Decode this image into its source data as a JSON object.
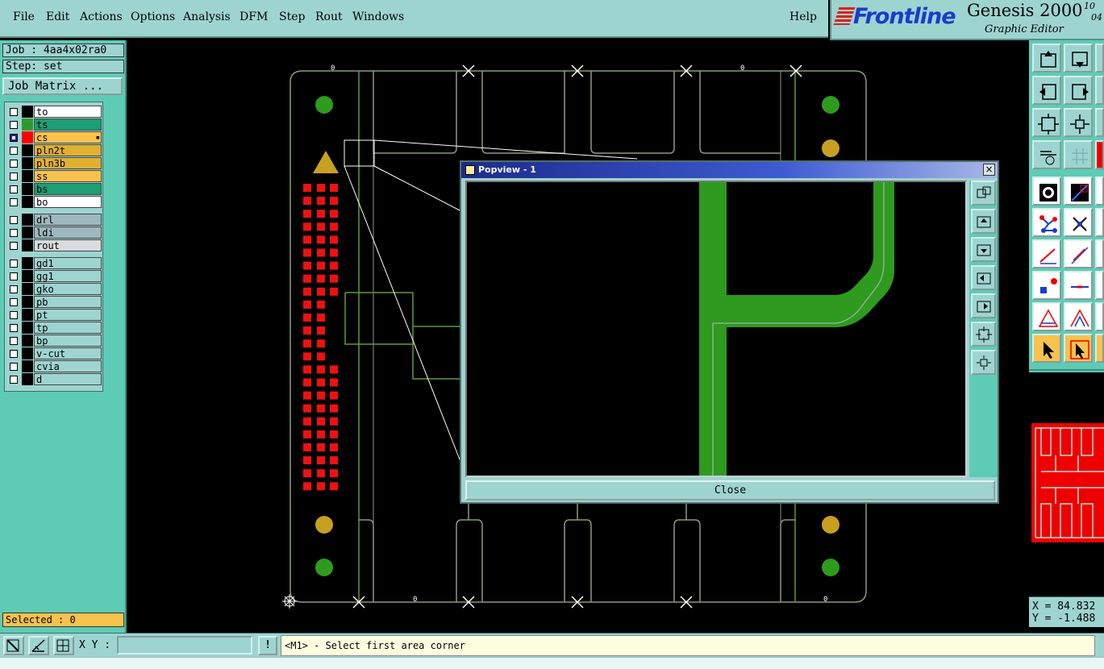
{
  "menubar": {
    "items": [
      "File",
      "Edit",
      "Actions",
      "Options",
      "Analysis",
      "DFM",
      "Step",
      "Rout",
      "Windows"
    ],
    "help": "Help"
  },
  "brand": {
    "logo": "Frontline",
    "product": "Genesis 2000",
    "subtitle": "Graphic Editor",
    "date_line1": "10",
    "date_line2": "04",
    "logo_color": "#1a3ccc"
  },
  "job": {
    "job_label": "Job : 4aa4x02ra0",
    "step_label": "Step: set",
    "matrix_button": "Job Matrix ..."
  },
  "layers": [
    {
      "name": "to",
      "color": "#ffffff",
      "swatch": "#000000",
      "checked": false
    },
    {
      "name": "ts",
      "color": "#1d9e73",
      "swatch": "#2e9a2e",
      "checked": false
    },
    {
      "name": "cs",
      "color": "#f7c24d",
      "swatch": "#ff0000",
      "checked": true,
      "marker": "▪"
    },
    {
      "name": "pln2t",
      "color": "#e0b030",
      "swatch": "#000000",
      "checked": false
    },
    {
      "name": "pln3b",
      "color": "#e0b030",
      "swatch": "#000000",
      "checked": false
    },
    {
      "name": "ss",
      "color": "#f7c24d",
      "swatch": "#000000",
      "checked": false
    },
    {
      "name": "bs",
      "color": "#1d9e73",
      "swatch": "#000000",
      "checked": false
    },
    {
      "name": "bo",
      "color": "#ffffff",
      "swatch": "#000000",
      "checked": false
    },
    {
      "name": "drl",
      "color": "#9fb8bd",
      "swatch": "#000000",
      "checked": false
    },
    {
      "name": "ldi",
      "color": "#9fb8bd",
      "swatch": "#000000",
      "checked": false
    },
    {
      "name": "rout",
      "color": "#d8dcdc",
      "swatch": "#000000",
      "checked": false
    },
    {
      "name": "gd1",
      "color": "#9ed4d0",
      "swatch": "#000000",
      "checked": false
    },
    {
      "name": "gg1",
      "color": "#9ed4d0",
      "swatch": "#000000",
      "checked": false
    },
    {
      "name": "gko",
      "color": "#9ed4d0",
      "swatch": "#000000",
      "checked": false
    },
    {
      "name": "pb",
      "color": "#9ed4d0",
      "swatch": "#000000",
      "checked": false
    },
    {
      "name": "pt",
      "color": "#9ed4d0",
      "swatch": "#000000",
      "checked": false
    },
    {
      "name": "tp",
      "color": "#9ed4d0",
      "swatch": "#000000",
      "checked": false
    },
    {
      "name": "bp",
      "color": "#9ed4d0",
      "swatch": "#000000",
      "checked": false
    },
    {
      "name": "v-cut",
      "color": "#9ed4d0",
      "swatch": "#000000",
      "checked": false
    },
    {
      "name": "cvia",
      "color": "#9ed4d0",
      "swatch": "#000000",
      "checked": false
    },
    {
      "name": "d",
      "color": "#9ed4d0",
      "swatch": "#000000",
      "checked": false
    }
  ],
  "selected_label": "Selected : 0",
  "board_labels": [
    "0",
    "0",
    "0",
    "0"
  ],
  "popview": {
    "title": "Popview - 1",
    "close_label": "Close",
    "close_x": "×"
  },
  "coords": {
    "x": "X = 84.832",
    "y": "Y = -1.488"
  },
  "bottombar": {
    "xy_label": "X Y :",
    "xy_value": "",
    "bang": "!",
    "prompt": "<M1> - Select first area corner"
  },
  "colors": {
    "panel": "#9ed4d0",
    "teal": "#5ecbb5",
    "trace": "#2e9a1e",
    "pad": "#ee1111",
    "outline": "#8aa870"
  }
}
